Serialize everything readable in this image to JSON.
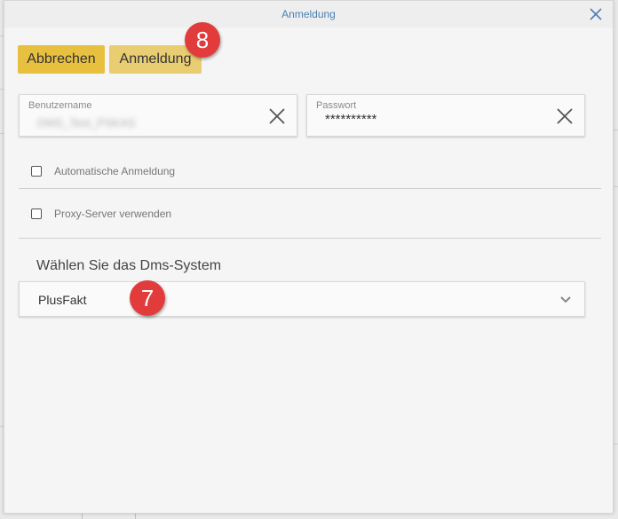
{
  "dialog": {
    "title": "Anmeldung"
  },
  "toolbar": {
    "cancel_label": "Abbrechen",
    "login_label": "Anmeldung"
  },
  "badges": {
    "login_step": "8",
    "dms_step": "7"
  },
  "form": {
    "username": {
      "label": "Benutzername",
      "value": "DMS_Test_PSKAS"
    },
    "password": {
      "label": "Passwort",
      "value": "**********"
    },
    "auto_login": {
      "label": "Automatische Anmeldung",
      "checked": false
    },
    "proxy": {
      "label": "Proxy-Server verwenden",
      "checked": false
    },
    "dms_section_title": "Wählen Sie das Dms-System",
    "dms_select": {
      "selected": "PlusFakt"
    }
  },
  "colors": {
    "accent_title": "#4a7fb5",
    "button_primary": "#e8c040",
    "button_secondary": "#e9cd72",
    "badge": "#e23b3b"
  },
  "icons": {
    "close": "close-icon",
    "clear": "clear-icon",
    "chevron": "chevron-down-icon"
  }
}
